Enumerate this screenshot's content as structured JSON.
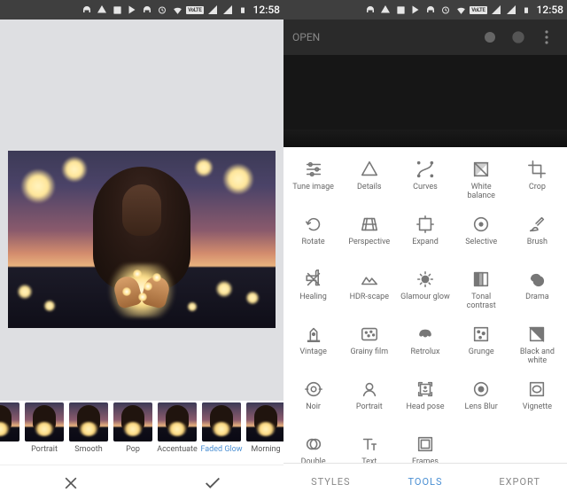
{
  "status": {
    "time": "12:58",
    "volte": "VoLTE"
  },
  "left": {
    "filters": [
      {
        "label": "",
        "active": false
      },
      {
        "label": "Portrait",
        "active": false
      },
      {
        "label": "Smooth",
        "active": false
      },
      {
        "label": "Pop",
        "active": false
      },
      {
        "label": "Accentuate",
        "active": false
      },
      {
        "label": "Faded Glow",
        "active": true
      },
      {
        "label": "Morning",
        "active": false
      }
    ]
  },
  "right": {
    "open_label": "OPEN",
    "tools": [
      {
        "label": "Tune image",
        "icon": "sliders"
      },
      {
        "label": "Details",
        "icon": "details"
      },
      {
        "label": "Curves",
        "icon": "curves"
      },
      {
        "label": "White balance",
        "icon": "wb"
      },
      {
        "label": "Crop",
        "icon": "crop"
      },
      {
        "label": "Rotate",
        "icon": "rotate"
      },
      {
        "label": "Perspective",
        "icon": "perspective"
      },
      {
        "label": "Expand",
        "icon": "expand"
      },
      {
        "label": "Selective",
        "icon": "selective"
      },
      {
        "label": "Brush",
        "icon": "brush"
      },
      {
        "label": "Healing",
        "icon": "healing"
      },
      {
        "label": "HDR-scape",
        "icon": "hdr"
      },
      {
        "label": "Glamour glow",
        "icon": "glow"
      },
      {
        "label": "Tonal contrast",
        "icon": "tonal"
      },
      {
        "label": "Drama",
        "icon": "drama"
      },
      {
        "label": "Vintage",
        "icon": "vintage"
      },
      {
        "label": "Grainy film",
        "icon": "grain"
      },
      {
        "label": "Retrolux",
        "icon": "retro"
      },
      {
        "label": "Grunge",
        "icon": "grunge"
      },
      {
        "label": "Black and white",
        "icon": "bw"
      },
      {
        "label": "Noir",
        "icon": "noir"
      },
      {
        "label": "Portrait",
        "icon": "portrait"
      },
      {
        "label": "Head pose",
        "icon": "head"
      },
      {
        "label": "Lens Blur",
        "icon": "lens"
      },
      {
        "label": "Vignette",
        "icon": "vignette"
      },
      {
        "label": "Double Exposure",
        "icon": "double"
      },
      {
        "label": "Text",
        "icon": "text"
      },
      {
        "label": "Frames",
        "icon": "frames"
      }
    ],
    "nav": {
      "styles": "STYLES",
      "tools": "TOOLS",
      "export": "EXPORT"
    }
  }
}
